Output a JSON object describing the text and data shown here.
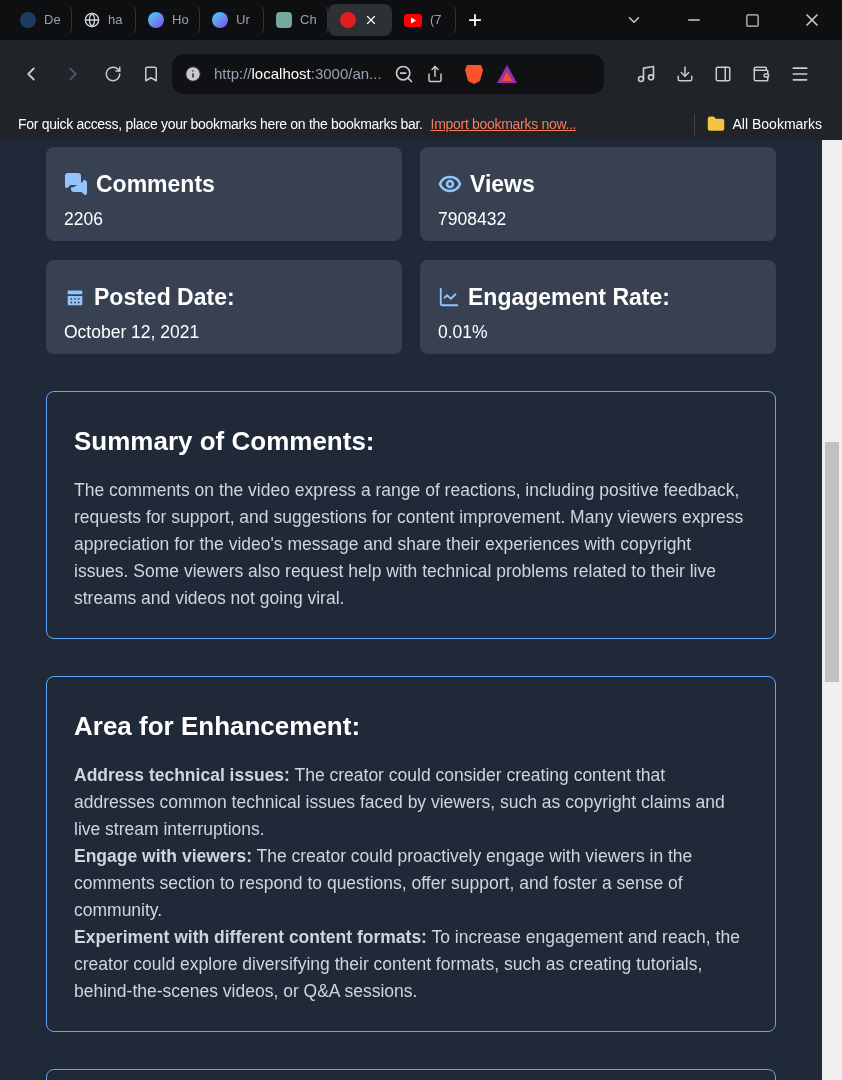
{
  "browser": {
    "tabs": [
      {
        "title": "De",
        "selected": false
      },
      {
        "title": "ha",
        "selected": false
      },
      {
        "title": "Ho",
        "selected": false
      },
      {
        "title": "Ur",
        "selected": false
      },
      {
        "title": "Ch",
        "selected": false
      },
      {
        "selected": true
      },
      {
        "title": "(7",
        "selected": false
      }
    ],
    "new_tab": "+",
    "address": {
      "scheme": "http://",
      "host": "localhost",
      "rest": ":3000/an..."
    },
    "bookmarks_bar": {
      "text": "For quick access, place your bookmarks here on the bookmarks bar.",
      "link": "Import bookmarks now...",
      "folder": "All Bookmarks"
    }
  },
  "stats": [
    {
      "label": "Comments",
      "value": "2206"
    },
    {
      "label": "Views",
      "value": "7908432"
    },
    {
      "label": "Posted Date:",
      "value": "October 12, 2021"
    },
    {
      "label": "Engagement Rate:",
      "value": "0.01%"
    }
  ],
  "summary": {
    "title": "Summary of Comments:",
    "text": "The comments on the video express a range of reactions, including positive feedback, requests for support, and suggestions for content improvement. Many viewers express appreciation for the video's message and share their experiences with copyright issues. Some viewers also request help with technical problems related to their live streams and videos not going viral."
  },
  "enhancement": {
    "title": "Area for Enhancement:",
    "items": [
      "**Address technical issues:** The creator could consider creating content that addresses common technical issues faced by viewers, such as copyright claims and live stream interruptions.",
      "**Engage with viewers:** The creator could proactively engage with viewers in the comments section to respond to questions, offer support, and foster a sense of community.",
      "**Experiment with different content formats:** To increase engagement and reach, the creator could explore diversifying their content formats, such as creating tutorials, behind-the-scenes videos, or Q&A sessions."
    ]
  }
}
